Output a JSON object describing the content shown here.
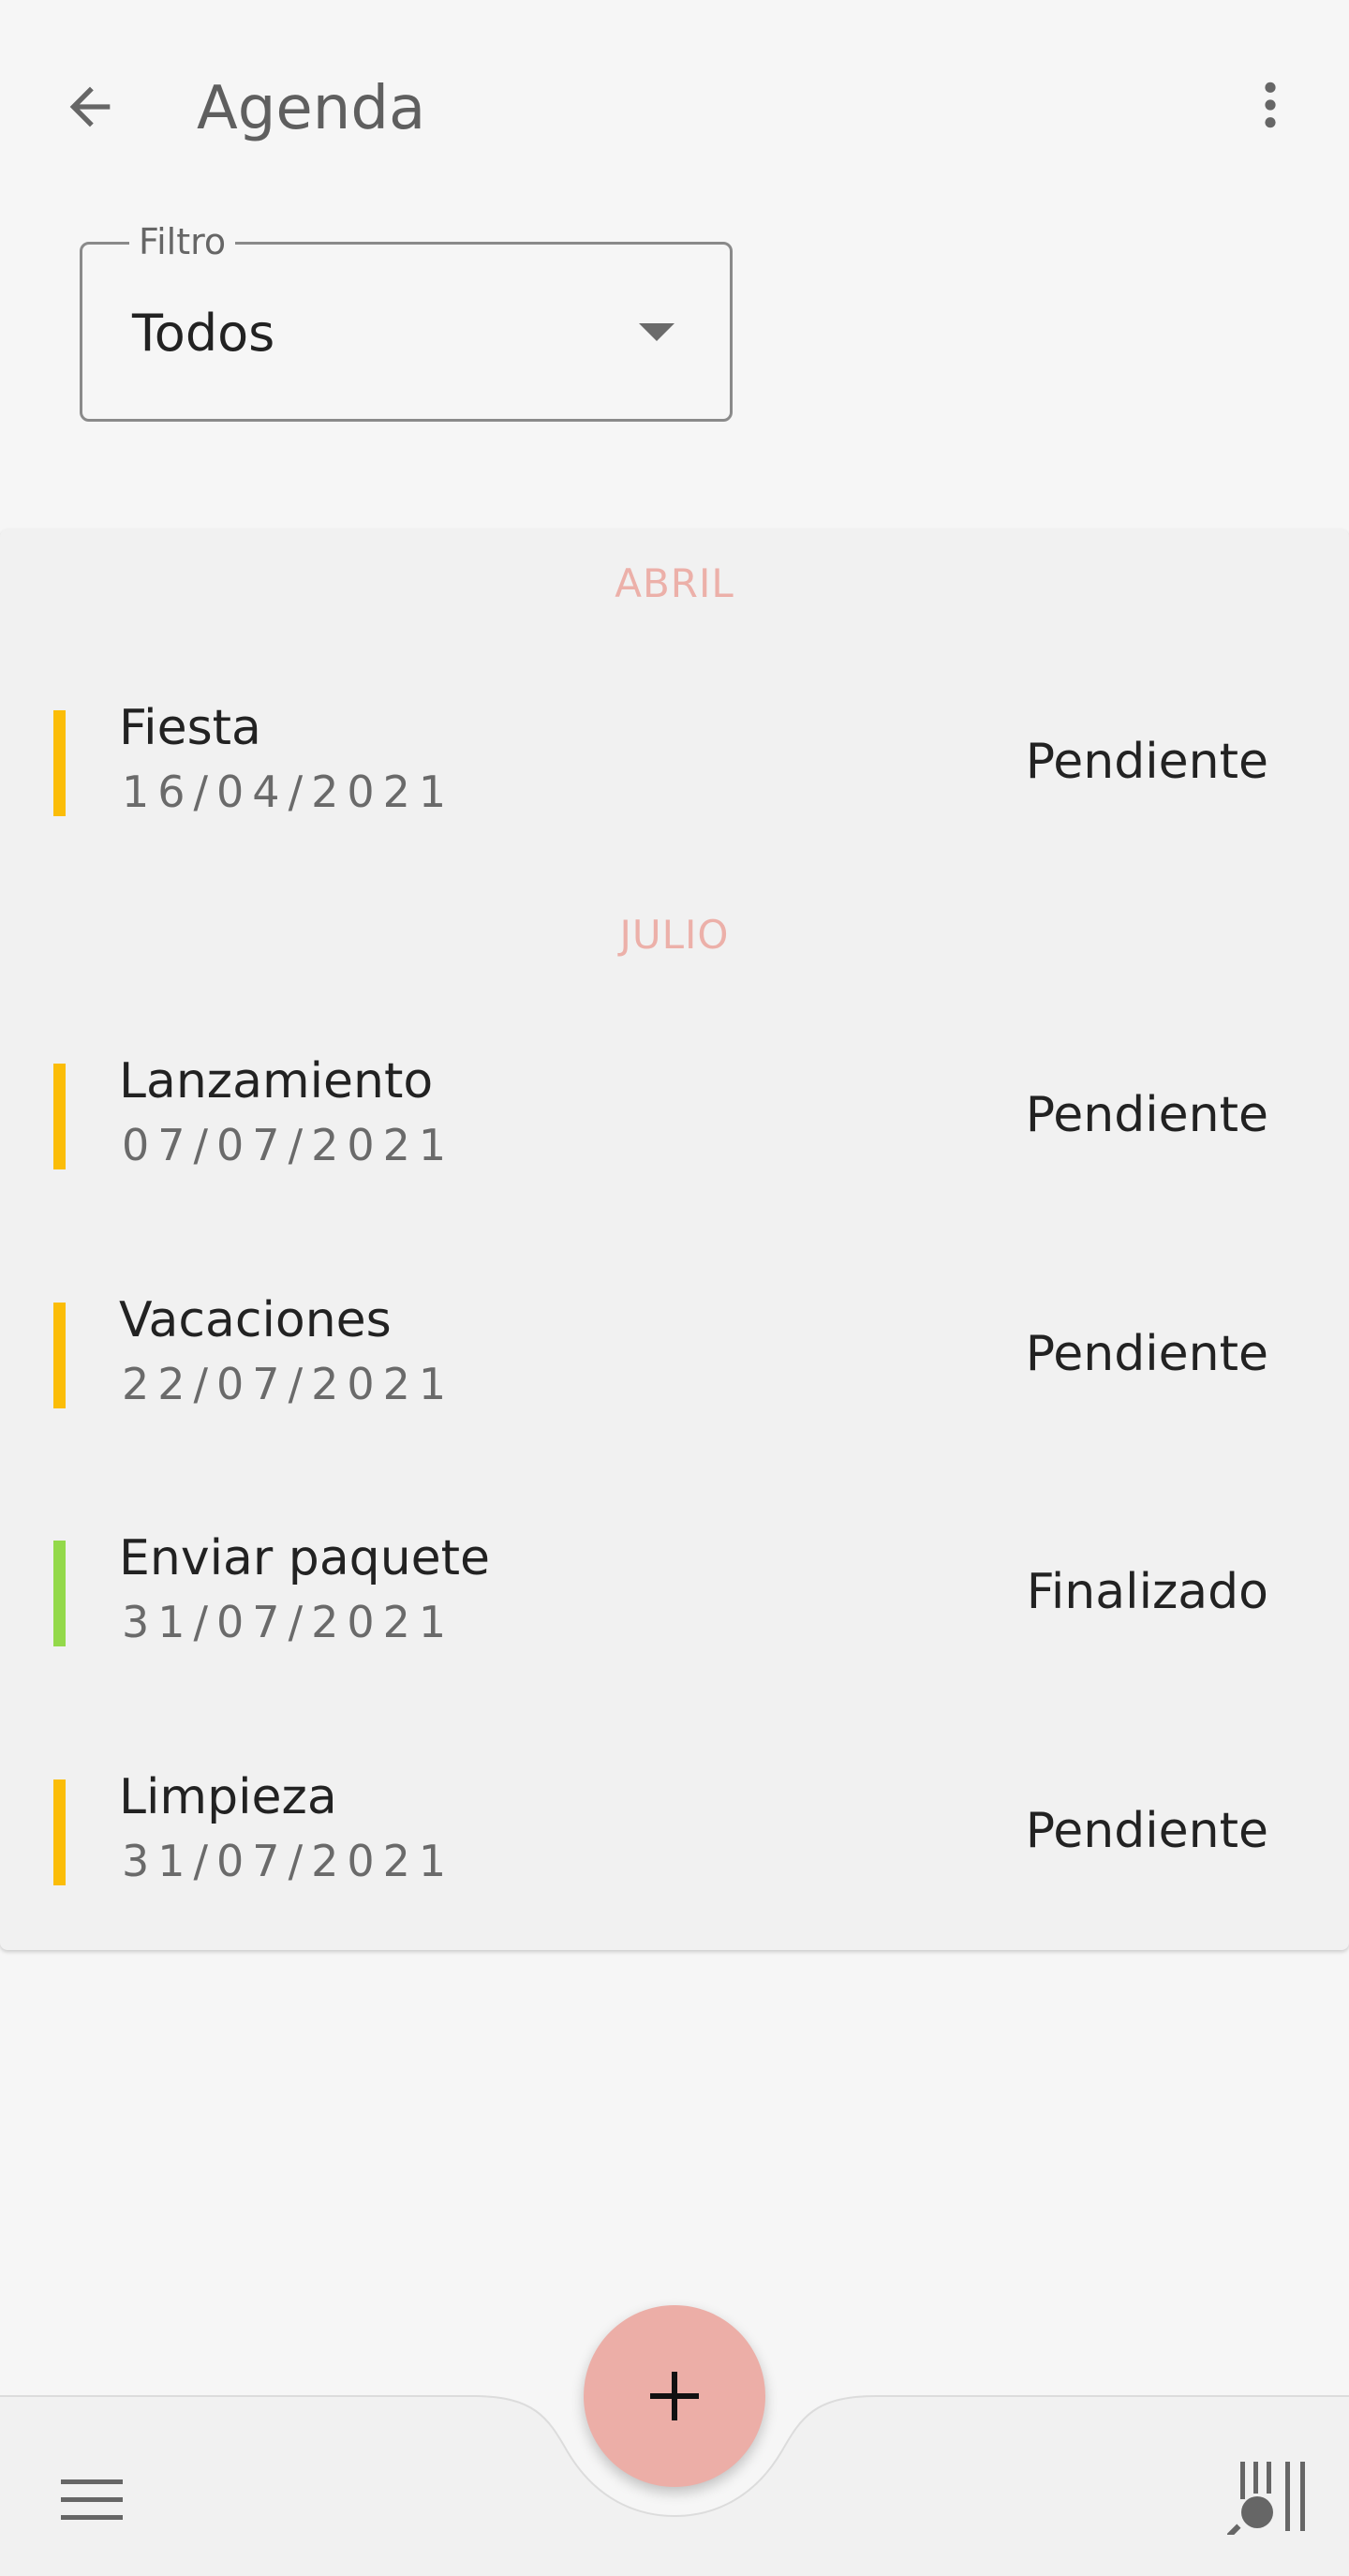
{
  "appbar": {
    "title": "Agenda",
    "back_icon": "arrow-left-icon",
    "more_icon": "more-vertical-icon"
  },
  "filter": {
    "label": "Filtro",
    "value": "Todos",
    "icon": "caret-down-icon"
  },
  "agenda": {
    "groups": [
      {
        "month": "ABRIL",
        "events": [
          {
            "title": "Fiesta",
            "date": "16/04/2021",
            "status": "Pendiente",
            "color": "#fbbd08"
          }
        ]
      },
      {
        "month": "JULIO",
        "events": [
          {
            "title": "Lanzamiento",
            "date": "07/07/2021",
            "status": "Pendiente",
            "color": "#fbbd08"
          },
          {
            "title": "Vacaciones",
            "date": "22/07/2021",
            "status": "Pendiente",
            "color": "#fbbd08"
          },
          {
            "title": "Enviar paquete",
            "date": "31/07/2021",
            "status": "Finalizado",
            "color": "#93d94a"
          },
          {
            "title": "Limpieza",
            "date": "31/07/2021",
            "status": "Pendiente",
            "color": "#fbbd08"
          }
        ]
      }
    ]
  },
  "bottombar": {
    "menu_icon": "menu-icon",
    "scan_icon": "barcode-scan-icon",
    "fab_icon": "plus-icon"
  },
  "colors": {
    "accent": "#ecaea7",
    "month_header": "#ecb0a9",
    "pending": "#fbbd08",
    "done": "#93d94a"
  }
}
